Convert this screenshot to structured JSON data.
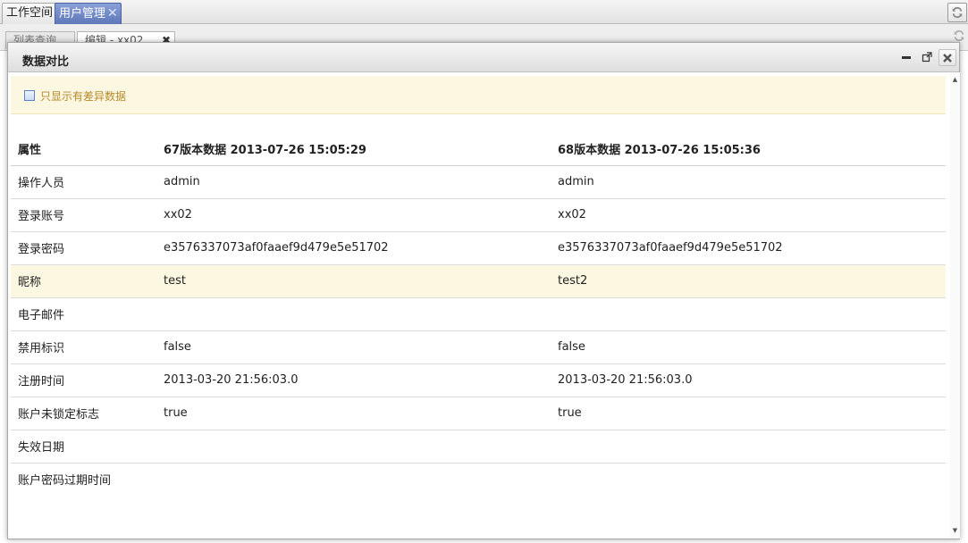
{
  "top_tabs": [
    {
      "label": "工作空间",
      "active": false
    },
    {
      "label": "用户管理",
      "active": true,
      "close": "✕"
    }
  ],
  "sub_tabs": [
    {
      "label": "列表查询"
    },
    {
      "label": "编辑 - xx02",
      "close": "✖"
    }
  ],
  "dialog": {
    "title": "数据对比",
    "filter_label": "只显示有差异数据",
    "filter_checked": false
  },
  "table": {
    "headers": [
      "属性",
      "67版本数据 2013-07-26 15:05:29",
      "68版本数据 2013-07-26 15:05:36"
    ],
    "rows": [
      {
        "attr": "操作人员",
        "v67": "admin",
        "v68": "admin",
        "diff": false
      },
      {
        "attr": "登录账号",
        "v67": "xx02",
        "v68": "xx02",
        "diff": false
      },
      {
        "attr": "登录密码",
        "v67": "e3576337073af0faaef9d479e5e51702",
        "v68": "e3576337073af0faaef9d479e5e51702",
        "diff": false
      },
      {
        "attr": "昵称",
        "v67": "test",
        "v68": "test2",
        "diff": true
      },
      {
        "attr": "电子邮件",
        "v67": "",
        "v68": "",
        "diff": false
      },
      {
        "attr": "禁用标识",
        "v67": "false",
        "v68": "false",
        "diff": false
      },
      {
        "attr": "注册时间",
        "v67": "2013-03-20 21:56:03.0",
        "v68": "2013-03-20 21:56:03.0",
        "diff": false
      },
      {
        "attr": "账户未锁定标志",
        "v67": "true",
        "v68": "true",
        "diff": false
      },
      {
        "attr": "失效日期",
        "v67": "",
        "v68": "",
        "diff": false
      },
      {
        "attr": "账户密码过期时间",
        "v67": "",
        "v68": "",
        "diff": false
      }
    ]
  },
  "colors": {
    "diff_highlight": "#fcf7e1",
    "active_tab": "#5e77b8",
    "filter_text": "#b58a2a"
  },
  "icons": {
    "refresh": "refresh-icon",
    "minimize": "minimize-icon",
    "maximize": "maximize-icon",
    "close": "close-icon"
  }
}
